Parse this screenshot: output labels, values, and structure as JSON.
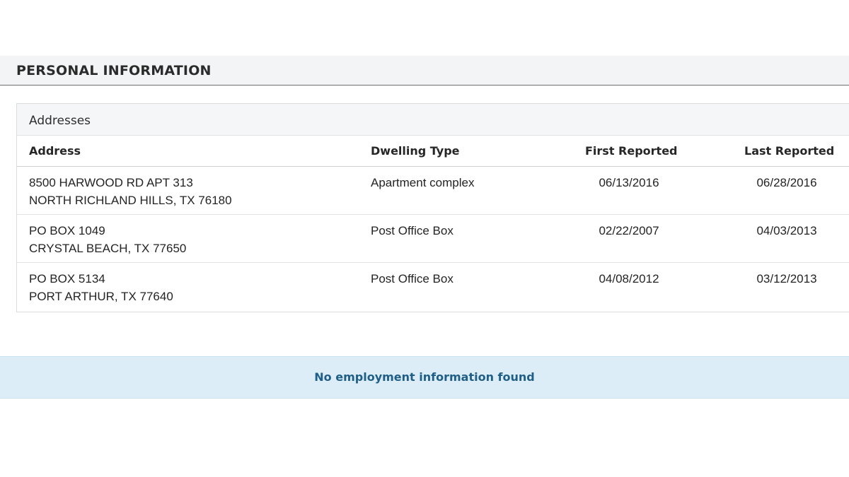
{
  "section": {
    "title": "PERSONAL INFORMATION"
  },
  "addresses": {
    "title": "Addresses",
    "columns": [
      "Address",
      "Dwelling Type",
      "First Reported",
      "Last Reported"
    ],
    "rows": [
      {
        "address_line1": "8500 HARWOOD RD APT 313",
        "address_line2": "NORTH RICHLAND HILLS, TX 76180",
        "dwelling_type": "Apartment complex",
        "first_reported": "06/13/2016",
        "last_reported": "06/28/2016"
      },
      {
        "address_line1": "PO BOX 1049",
        "address_line2": "CRYSTAL BEACH, TX 77650",
        "dwelling_type": "Post Office Box",
        "first_reported": "02/22/2007",
        "last_reported": "04/03/2013"
      },
      {
        "address_line1": "PO BOX 5134",
        "address_line2": "PORT ARTHUR, TX 77640",
        "dwelling_type": "Post Office Box",
        "first_reported": "04/08/2012",
        "last_reported": "03/12/2013"
      }
    ]
  },
  "employment": {
    "notice": "No employment information found"
  },
  "colors": {
    "notice_background": "#dcedf7",
    "notice_text": "#1f5f87",
    "header_background": "#f3f4f5"
  }
}
